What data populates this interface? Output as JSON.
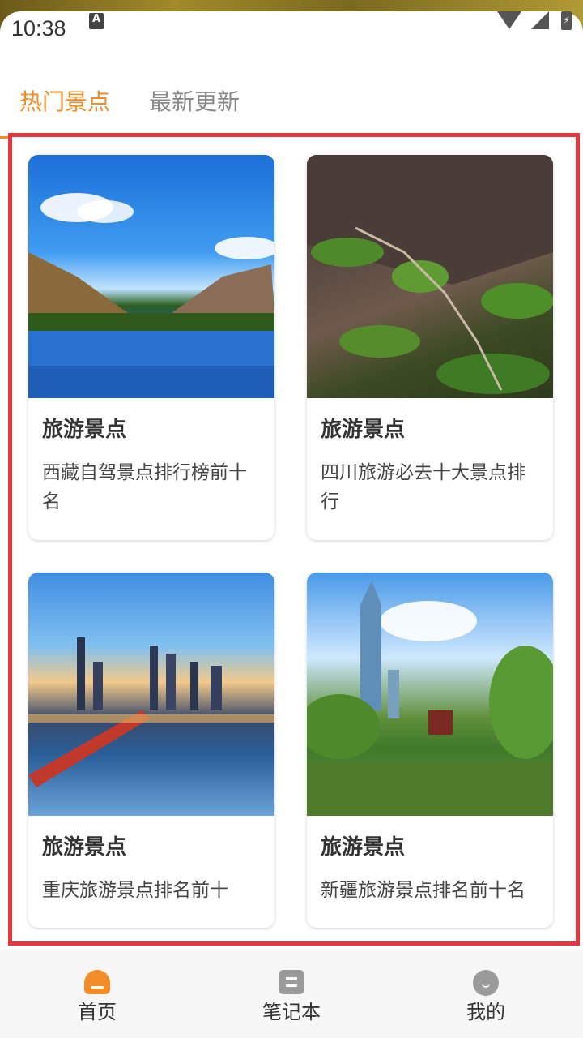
{
  "status_bar": {
    "time": "10:38",
    "notification_glyph": "A"
  },
  "tabs": [
    {
      "label": "热门景点",
      "active": true
    },
    {
      "label": "最新更新",
      "active": false
    }
  ],
  "accent_color": "#f28c28",
  "highlight_color": "#e3393c",
  "cards": [
    {
      "title": "旅游景点",
      "desc": "西藏自驾景点排行榜前十名",
      "image": "mountain-lake-photo"
    },
    {
      "title": "旅游景点",
      "desc": "四川旅游必去十大景点排行",
      "image": "cliff-trail-photo"
    },
    {
      "title": "旅游景点",
      "desc": "重庆旅游景点排名前十",
      "image": "city-river-photo"
    },
    {
      "title": "旅游景点",
      "desc": "新疆旅游景点排名前十名",
      "image": "park-lake-photo"
    }
  ],
  "bottom_nav": [
    {
      "label": "首页",
      "icon": "home-icon",
      "active": true
    },
    {
      "label": "笔记本",
      "icon": "notebook-icon",
      "active": false
    },
    {
      "label": "我的",
      "icon": "profile-icon",
      "active": false
    }
  ]
}
